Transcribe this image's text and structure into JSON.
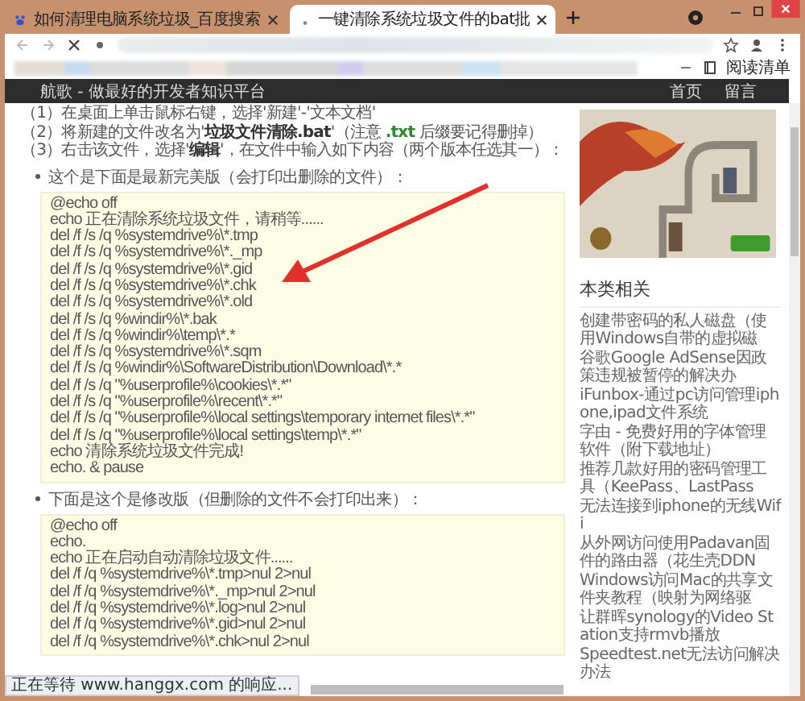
{
  "browser": {
    "tabs": [
      {
        "title": "如何清理电脑系统垃圾_百度搜索",
        "selected": false
      },
      {
        "title": "一键清除系统垃圾文件的bat批",
        "selected": true
      }
    ],
    "reading_list": "阅读清单"
  },
  "site_header": {
    "title": "航歌 - 做最好的开发者知识平台",
    "nav": [
      {
        "label": "首页"
      },
      {
        "label": "留言"
      }
    ]
  },
  "article": {
    "steps": [
      {
        "segments": [
          {
            "kind": "plain",
            "text": "（1）在桌面上单击鼠标右键，选择'新建'-'文本文档'"
          }
        ]
      },
      {
        "segments": [
          {
            "kind": "plain",
            "text": "（2）将新建的文件改名为'"
          },
          {
            "kind": "bold",
            "text": "垃圾文件清除.bat"
          },
          {
            "kind": "plain",
            "text": "'（注意 "
          },
          {
            "kind": "code",
            "text": ".txt"
          },
          {
            "kind": "plain",
            "text": " 后缀要记得删掉）"
          }
        ]
      },
      {
        "segments": [
          {
            "kind": "plain",
            "text": "（3）右击该文件，选择'"
          },
          {
            "kind": "bold",
            "text": "编辑"
          },
          {
            "kind": "plain",
            "text": "'，在文件中输入如下内容（两个版本任选其一）："
          }
        ]
      }
    ],
    "versions": [
      {
        "caption": "这个是下面是最新完美版（会打印出删除的文件）：",
        "code": [
          "@echo off",
          "echo 正在清除系统垃圾文件，请稍等......",
          "del /f /s /q %systemdrive%\\*.tmp",
          "del /f /s /q %systemdrive%\\*._mp",
          "del /f /s /q %systemdrive%\\*.gid",
          "del /f /s /q %systemdrive%\\*.chk",
          "del /f /s /q %systemdrive%\\*.old",
          "del /f /s /q %windir%\\*.bak",
          "del /f /s /q %windir%\\temp\\*.*",
          "del /f /s /q %systemdrive%\\*.sqm",
          "del /f /s /q %windir%\\SoftwareDistribution\\Download\\*.*",
          "del /f /s /q \"%userprofile%\\cookies\\*.*\"",
          "del /f /s /q \"%userprofile%\\recent\\*.*\"",
          "del /f /s /q \"%userprofile%\\local settings\\temporary internet files\\*.*\"",
          "del /f /s /q \"%userprofile%\\local settings\\temp\\*.*\"",
          "echo 清除系统垃圾文件完成!",
          "echo. & pause"
        ]
      },
      {
        "caption": "下面是这个是修改版（但删除的文件不会打印出来）：",
        "code": [
          "@echo off",
          "echo.",
          "echo 正在启动自动清除垃圾文件......",
          "del /f /q %systemdrive%\\*.tmp>nul 2>nul",
          "del /f /q %systemdrive%\\*._mp>nul 2>nul",
          "del /f /q %systemdrive%\\*.log>nul 2>nul",
          "del /f /q %systemdrive%\\*.gid>nul 2>nul",
          "del /f /q %systemdrive%\\*.chk>nul 2>nul"
        ]
      }
    ]
  },
  "sidebar": {
    "heading": "本类相关",
    "links": [
      "创建带密码的私人磁盘（使用Windows自带的虚拟磁",
      "谷歌Google AdSense因政策违规被暂停的解决办",
      "iFunbox-通过pc访问管理iphone,ipad文件系统",
      "字由 - 免费好用的字体管理软件（附下载地址）",
      "推荐几款好用的密码管理工具（KeePass、LastPass",
      "无法连接到iphone的无线Wifi",
      "从外网访问使用Padavan固件的路由器（花生壳DDN",
      "Windows访问Mac的共享文件夹教程（映射为网络驱",
      "让群晖synology的Video Station支持rmvb播放",
      "Speedtest.net无法访问解决办法"
    ]
  },
  "status_bar": "正在等待 www.hanggx.com 的响应..."
}
